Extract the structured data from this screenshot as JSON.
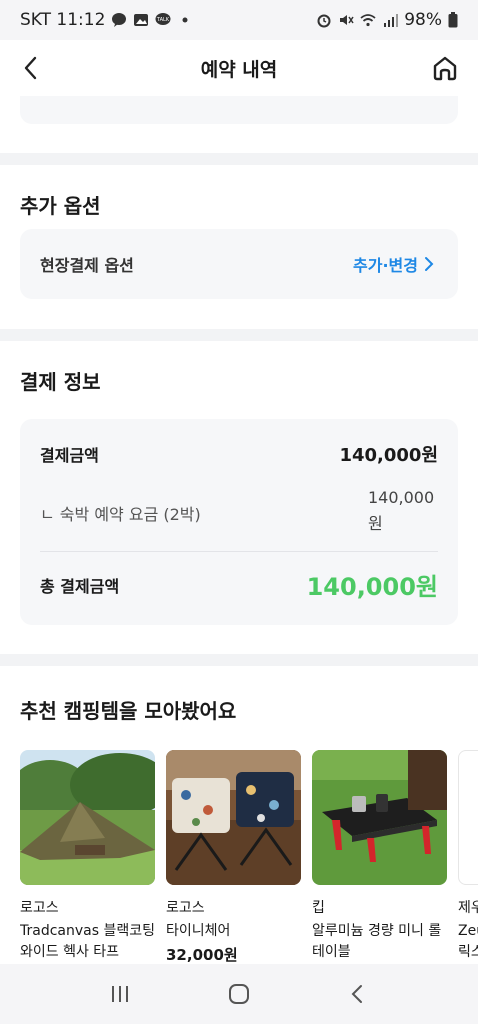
{
  "status_bar": {
    "carrier_time": "SKT 11:12",
    "battery": "98%"
  },
  "header": {
    "title": "예약 내역"
  },
  "add_options": {
    "title": "추가 옵션",
    "item_label": "현장결제 옵션",
    "action_label": "추가·변경"
  },
  "payment": {
    "title": "결제 정보",
    "amount_label": "결제금액",
    "amount_value": "140,000원",
    "sub_label": "ㄴ 숙박 예약 요금 (2박)",
    "sub_value": "140,000원",
    "total_label": "총 결제금액",
    "total_value": "140,000원"
  },
  "recommend": {
    "title": "추천 캠핑템을 모아봤어요",
    "items": [
      {
        "brand": "로고스",
        "name": "Tradcanvas 블랙코팅 와이드 헥사 타프",
        "price": ""
      },
      {
        "brand": "로고스",
        "name": "타이니체어",
        "price": "32,000원"
      },
      {
        "brand": "킵",
        "name": "알루미늄 경량 미니 롤 테이블",
        "price": ""
      },
      {
        "brand": "제우",
        "name": "Zeu 릭스",
        "price": ""
      }
    ]
  }
}
